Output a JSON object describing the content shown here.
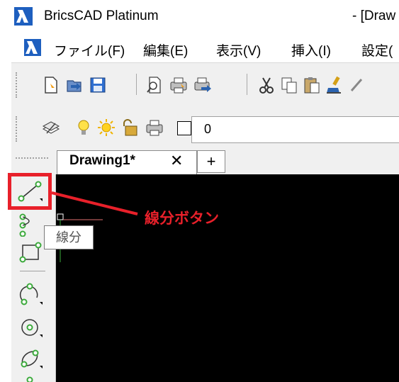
{
  "titlebar": {
    "app_title": "BricsCAD Platinum",
    "doc_title_fragment": "- [Draw"
  },
  "menubar": {
    "items": [
      "ファイル(F)",
      "編集(E)",
      "表示(V)",
      "挿入(I)",
      "設定("
    ]
  },
  "layer_toolbar": {
    "current_layer": "0"
  },
  "tabs": {
    "active_label": "Drawing1*",
    "close_glyph": "✕",
    "add_glyph": "+"
  },
  "tooltip": {
    "text": "線分"
  },
  "callout": {
    "label": "線分ボタン",
    "color": "#e8202a"
  },
  "colors": {
    "canvas_bg": "#000000",
    "accent_red": "#e8202a",
    "icon_green": "#3caa3c"
  },
  "side_tools": [
    "line-icon",
    "polyline-icon",
    "rectangle-icon",
    "arc-icon",
    "circle-icon",
    "ellipse-icon"
  ]
}
